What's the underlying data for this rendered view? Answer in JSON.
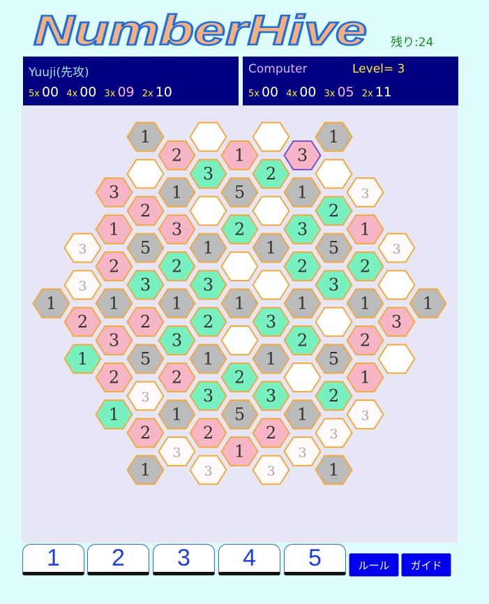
{
  "app": {
    "title": "NumberHive",
    "remaining": "残り:24"
  },
  "player": {
    "name": "Yuuji(先攻)",
    "scores": [
      {
        "mul": "5x",
        "val": "00"
      },
      {
        "mul": "4x",
        "val": "00"
      },
      {
        "mul": "3x",
        "val": "09"
      },
      {
        "mul": "2x",
        "val": "10"
      }
    ]
  },
  "computer": {
    "name": "Computer",
    "level": "Level= 3",
    "scores": [
      {
        "mul": "5x",
        "val": "00"
      },
      {
        "mul": "4x",
        "val": "00"
      },
      {
        "mul": "3x",
        "val": "05"
      },
      {
        "mul": "2x",
        "val": "11"
      }
    ]
  },
  "colors": {
    "gray": "#bbbbbb",
    "pink": "#f7b6c6",
    "green": "#78f0c0",
    "empty": "#ffffff",
    "hint": "#fffafa",
    "board": "#e6e6f7",
    "panel": "#000080"
  },
  "board": {
    "rows": [
      [
        {
          "n": "1",
          "t": "gray"
        },
        {
          "n": "",
          "t": "empty"
        },
        {
          "n": "",
          "t": "empty"
        },
        {
          "n": "1",
          "t": "gray"
        }
      ],
      [
        {
          "n": "2",
          "t": "pink"
        },
        {
          "n": "1",
          "t": "pink"
        },
        {
          "n": "3",
          "t": "pink",
          "sel": true
        }
      ],
      [
        {
          "n": "",
          "t": "empty"
        },
        {
          "n": "3",
          "t": "green"
        },
        {
          "n": "2",
          "t": "green"
        },
        {
          "n": "",
          "t": "empty"
        }
      ],
      [
        {
          "n": "3",
          "t": "pink"
        },
        {
          "n": "1",
          "t": "gray"
        },
        {
          "n": "5",
          "t": "gray"
        },
        {
          "n": "1",
          "t": "gray"
        },
        {
          "n": "3",
          "t": "hint"
        }
      ],
      [
        {
          "n": "2",
          "t": "pink"
        },
        {
          "n": "",
          "t": "empty"
        },
        {
          "n": "",
          "t": "empty"
        },
        {
          "n": "2",
          "t": "green"
        }
      ],
      [
        {
          "n": "1",
          "t": "pink"
        },
        {
          "n": "3",
          "t": "pink"
        },
        {
          "n": "2",
          "t": "green"
        },
        {
          "n": "3",
          "t": "green"
        },
        {
          "n": "1",
          "t": "pink"
        }
      ],
      [
        {
          "n": "3",
          "t": "hint"
        },
        {
          "n": "5",
          "t": "gray"
        },
        {
          "n": "1",
          "t": "gray"
        },
        {
          "n": "1",
          "t": "gray"
        },
        {
          "n": "5",
          "t": "gray"
        },
        {
          "n": "3",
          "t": "hint"
        }
      ],
      [
        {
          "n": "2",
          "t": "pink"
        },
        {
          "n": "2",
          "t": "green"
        },
        {
          "n": "",
          "t": "empty"
        },
        {
          "n": "2",
          "t": "green"
        },
        {
          "n": "2",
          "t": "green"
        }
      ],
      [
        {
          "n": "3",
          "t": "hint"
        },
        {
          "n": "3",
          "t": "green"
        },
        {
          "n": "3",
          "t": "green"
        },
        {
          "n": "",
          "t": "empty"
        },
        {
          "n": "3",
          "t": "green"
        },
        {
          "n": "",
          "t": "empty"
        }
      ],
      [
        {
          "n": "1",
          "t": "gray"
        },
        {
          "n": "1",
          "t": "gray"
        },
        {
          "n": "1",
          "t": "gray"
        },
        {
          "n": "1",
          "t": "gray"
        },
        {
          "n": "1",
          "t": "gray"
        },
        {
          "n": "1",
          "t": "gray"
        },
        {
          "n": "1",
          "t": "gray"
        }
      ],
      [
        {
          "n": "2",
          "t": "pink"
        },
        {
          "n": "2",
          "t": "pink"
        },
        {
          "n": "2",
          "t": "green"
        },
        {
          "n": "3",
          "t": "green"
        },
        {
          "n": "",
          "t": "empty"
        },
        {
          "n": "3",
          "t": "pink"
        }
      ],
      [
        {
          "n": "3",
          "t": "pink"
        },
        {
          "n": "3",
          "t": "green"
        },
        {
          "n": "",
          "t": "empty"
        },
        {
          "n": "2",
          "t": "green"
        },
        {
          "n": "2",
          "t": "pink"
        }
      ],
      [
        {
          "n": "1",
          "t": "green"
        },
        {
          "n": "5",
          "t": "gray"
        },
        {
          "n": "1",
          "t": "gray"
        },
        {
          "n": "1",
          "t": "gray"
        },
        {
          "n": "5",
          "t": "gray"
        },
        {
          "n": "",
          "t": "empty"
        }
      ],
      [
        {
          "n": "2",
          "t": "pink"
        },
        {
          "n": "2",
          "t": "pink"
        },
        {
          "n": "2",
          "t": "green"
        },
        {
          "n": "",
          "t": "empty"
        },
        {
          "n": "1",
          "t": "pink"
        }
      ],
      [
        {
          "n": "3",
          "t": "hint"
        },
        {
          "n": "3",
          "t": "green"
        },
        {
          "n": "3",
          "t": "green"
        },
        {
          "n": "2",
          "t": "green"
        }
      ],
      [
        {
          "n": "1",
          "t": "green"
        },
        {
          "n": "1",
          "t": "gray"
        },
        {
          "n": "5",
          "t": "gray"
        },
        {
          "n": "1",
          "t": "gray"
        },
        {
          "n": "3",
          "t": "hint"
        }
      ],
      [
        {
          "n": "2",
          "t": "pink"
        },
        {
          "n": "2",
          "t": "pink"
        },
        {
          "n": "2",
          "t": "pink"
        },
        {
          "n": "3",
          "t": "hint"
        }
      ],
      [
        {
          "n": "3",
          "t": "hint"
        },
        {
          "n": "1",
          "t": "pink"
        },
        {
          "n": "3",
          "t": "hint"
        }
      ],
      [
        {
          "n": "1",
          "t": "gray"
        },
        {
          "n": "3",
          "t": "hint"
        },
        {
          "n": "3",
          "t": "hint"
        },
        {
          "n": "1",
          "t": "gray"
        }
      ]
    ]
  },
  "buttons": {
    "numbers": [
      "1",
      "2",
      "3",
      "4",
      "5"
    ],
    "rule": "ルール",
    "guide": "ガイド"
  }
}
